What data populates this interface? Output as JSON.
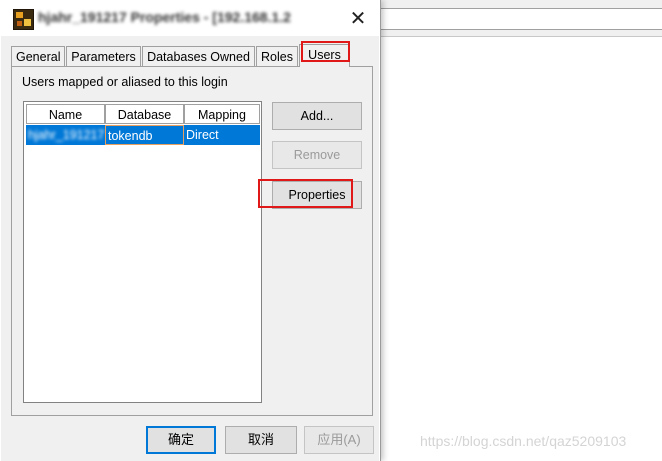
{
  "window": {
    "title": "hjahr_191217 Properties - [192.168.1.2",
    "close_glyph": "✕"
  },
  "tabs": [
    {
      "label": "General"
    },
    {
      "label": "Parameters"
    },
    {
      "label": "Databases Owned"
    },
    {
      "label": "Roles"
    },
    {
      "label": "Users",
      "active": true
    }
  ],
  "panel": {
    "caption": "Users mapped or aliased to this login"
  },
  "list": {
    "columns": [
      "Name",
      "Database",
      "Mapping"
    ],
    "rows": [
      {
        "name": "hjahr_191217",
        "database": "tokendb",
        "mapping": "Direct",
        "selected": true
      }
    ]
  },
  "buttons": {
    "add": "Add...",
    "remove": "Remove",
    "properties": "Properties"
  },
  "footer": {
    "ok": "确定",
    "cancel": "取消",
    "apply": "应用(A)"
  },
  "watermark": "https://blog.csdn.net/qaz5209103",
  "colors": {
    "selection": "#0078d7",
    "highlight_box": "#e01818",
    "dialog_bg": "#f0f0f0"
  },
  "icons": {
    "app": "app-icon",
    "close": "close-icon"
  }
}
